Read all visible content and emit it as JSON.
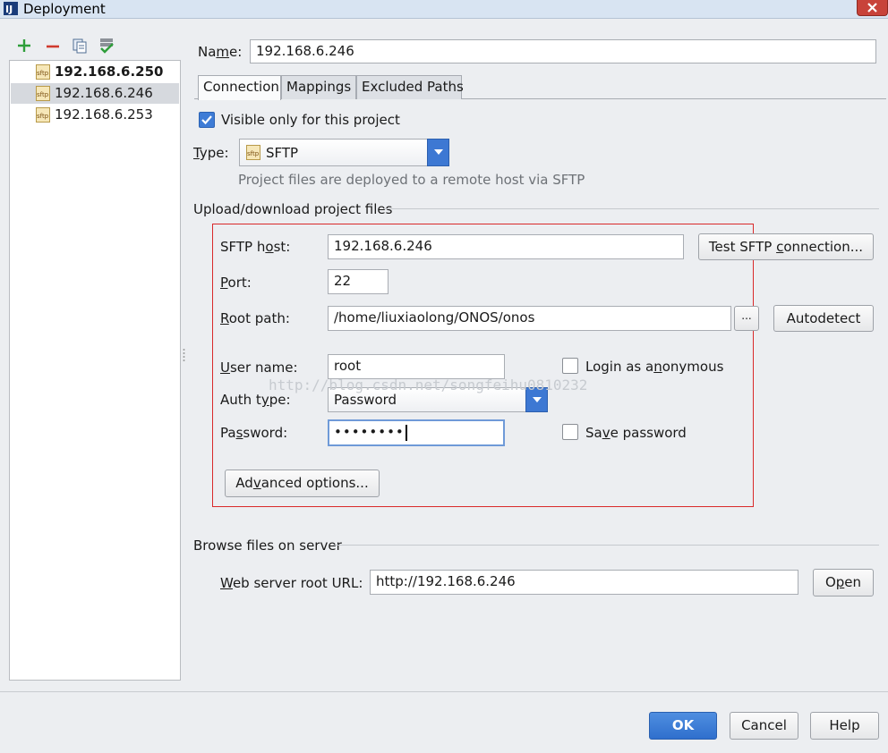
{
  "window": {
    "title": "Deployment",
    "app_icon": "intellij-icon"
  },
  "toolbar": {
    "add_icon": "plus-icon",
    "remove_icon": "minus-icon",
    "copy_icon": "copy-icon",
    "default_icon": "check-server-icon"
  },
  "servers": [
    {
      "label": "192.168.6.250",
      "bold": true,
      "selected": false
    },
    {
      "label": "192.168.6.246",
      "bold": false,
      "selected": true
    },
    {
      "label": "192.168.6.253",
      "bold": false,
      "selected": false
    }
  ],
  "name_field": {
    "label_pre": "Na",
    "label_mnemonic": "m",
    "label_post": "e:",
    "value": "192.168.6.246"
  },
  "tabs": [
    {
      "label": "Connection",
      "active": true
    },
    {
      "label": "Mappings",
      "active": false
    },
    {
      "label": "Excluded Paths",
      "active": false
    }
  ],
  "visible_only": {
    "label": "Visible only for this project",
    "checked": true
  },
  "type": {
    "label_mnemonic": "T",
    "label_post": "ype:",
    "value": "SFTP",
    "hint": "Project files are deployed to a remote host via SFTP"
  },
  "upload_section": {
    "title": "Upload/download project files"
  },
  "sftp_host": {
    "label_pre": "SFTP h",
    "label_mnemonic": "o",
    "label_post": "st:",
    "value": "192.168.6.246"
  },
  "test_button": {
    "label_pre": "Test SFTP ",
    "label_mnemonic": "c",
    "label_post": "onnection..."
  },
  "port": {
    "label_mnemonic": "P",
    "label_post": "ort:",
    "value": "22"
  },
  "root_path": {
    "label_mnemonic": "R",
    "label_post": "oot path:",
    "value": "/home/liuxiaolong/ONOS/onos",
    "browse_label": "...",
    "autodetect_label": "Autodetect"
  },
  "user_name": {
    "label_mnemonic": "U",
    "label_post": "ser name:",
    "value": "root"
  },
  "anonymous": {
    "label_pre": "Login as a",
    "label_mnemonic": "n",
    "label_post": "onymous",
    "checked": false
  },
  "auth_type": {
    "label_pre": "Auth t",
    "label_mnemonic": "y",
    "label_post": "pe:",
    "value": "Password"
  },
  "password": {
    "label_pre": "Pa",
    "label_mnemonic": "s",
    "label_post": "sword:",
    "value": "••••••••"
  },
  "save_password": {
    "label_pre": "Sa",
    "label_mnemonic": "v",
    "label_post": "e password",
    "checked": false
  },
  "advanced_button": {
    "label_pre": "Ad",
    "label_mnemonic": "v",
    "label_post": "anced options..."
  },
  "watermark": "http://blog.csdn.net/songfeihu0810232",
  "browse_section": {
    "title": "Browse files on server"
  },
  "web_url": {
    "label_mnemonic": "W",
    "label_post": "eb server root URL:",
    "value": "http://192.168.6.246",
    "open_pre": "O",
    "open_mnemonic": "p",
    "open_post": "en"
  },
  "footer": {
    "ok_label": "OK",
    "cancel_label": "Cancel",
    "help_label": "Help"
  },
  "colors": {
    "accent": "#3d78d3",
    "highlight_frame": "#d9292a",
    "selection": "#d6d9de"
  }
}
